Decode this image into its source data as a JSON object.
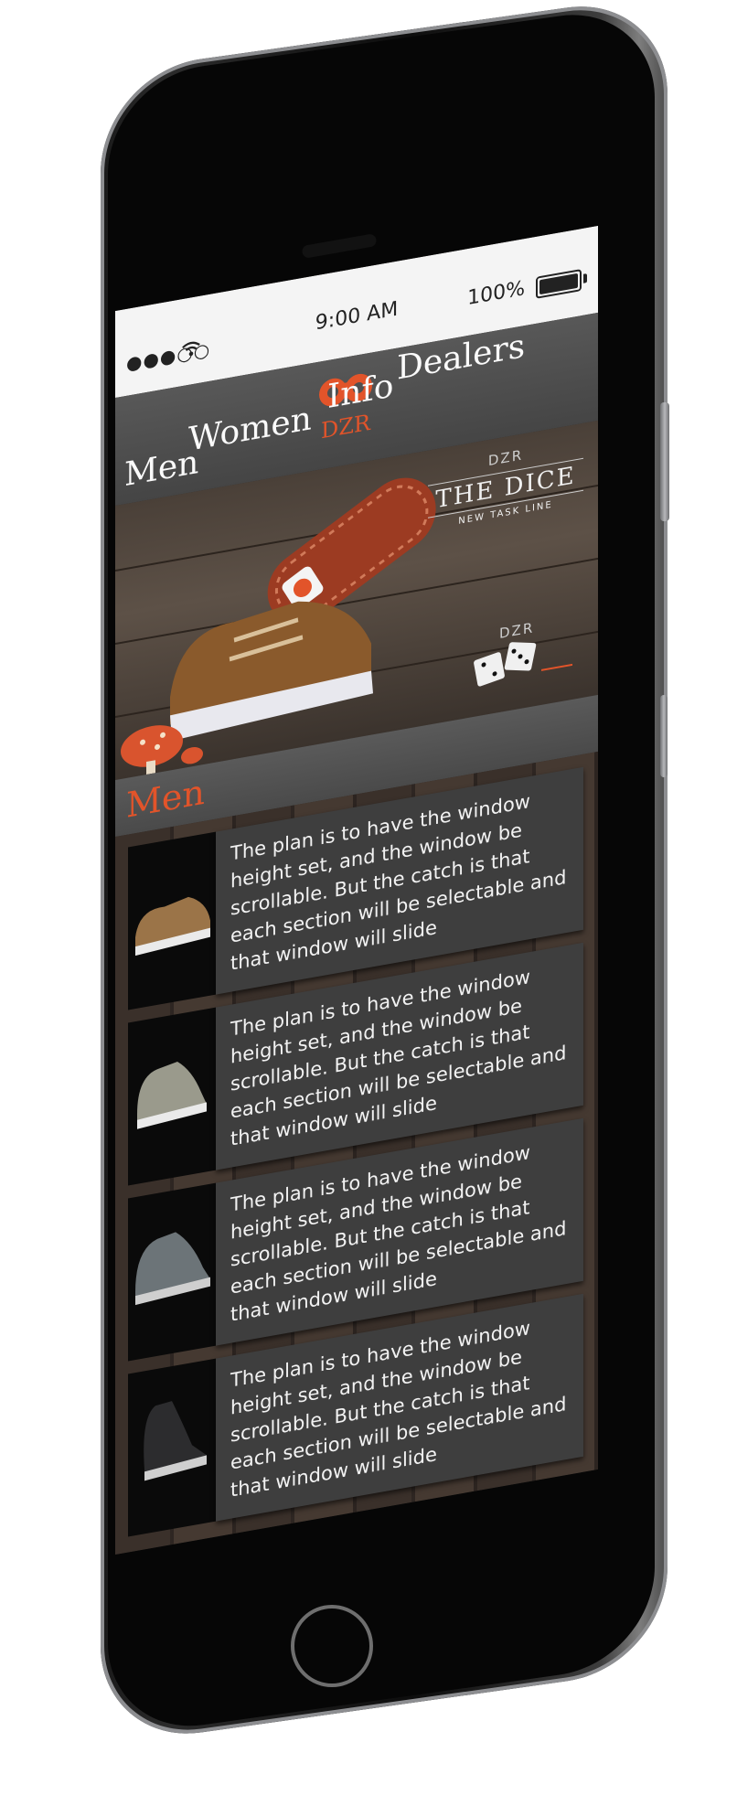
{
  "status": {
    "signal": "●●●○○",
    "time": "9:00 AM",
    "battery": "100%"
  },
  "nav": {
    "items": [
      "Men",
      "Women",
      "Info",
      "Dealers"
    ],
    "logo_text": "DZR"
  },
  "hero": {
    "brand_small": "DZR",
    "brand_title": "THE DICE",
    "brand_subtitle": "NEW TASK LINE",
    "dice_brand": "DZR"
  },
  "section": {
    "title": "Men"
  },
  "products": [
    {
      "description": "The plan is to have the window height set, and the window be scrollable. But the catch is that each section will be selectable and that window will slide",
      "shoe_color": "#9b7448"
    },
    {
      "description": "The plan is to have the window height set, and the window be scrollable. But the catch is that each section will be selectable and that window will slide",
      "shoe_color": "#9a9a8c"
    },
    {
      "description": "The plan is to have the window height set, and the window be scrollable. But the catch is that each section will be selectable and that window will slide",
      "shoe_color": "#6c7478"
    },
    {
      "description": "The plan is to have the window height set, and the window be scrollable. But the catch is that each section will be selectable and that window will slide",
      "shoe_color": "#2c2c2e"
    }
  ],
  "colors": {
    "accent": "#e2542a",
    "nav_bg": "#505050",
    "card_bg": "#3e3e3e"
  }
}
